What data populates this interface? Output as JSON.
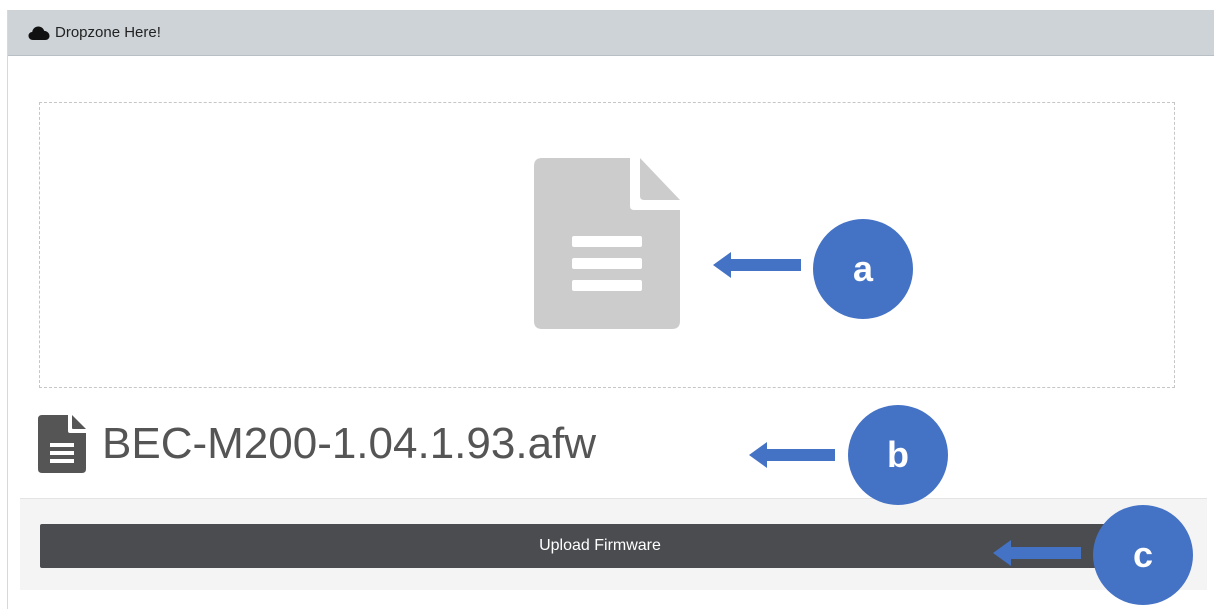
{
  "header": {
    "title": "Dropzone Here!",
    "icon": "cloud-icon"
  },
  "dropzone": {
    "icon": "file-document-icon"
  },
  "file": {
    "name": "BEC-M200-1.04.1.93.afw",
    "icon": "file-text-icon"
  },
  "actions": {
    "upload_label": "Upload Firmware"
  },
  "callouts": [
    {
      "label": "a"
    },
    {
      "label": "b"
    },
    {
      "label": "c"
    }
  ],
  "colors": {
    "header_bg": "#cdd3d7",
    "button_bg": "#4a4c50",
    "callout": "#4472c4",
    "doc_icon": "#cccccc",
    "file_icon": "#555555"
  }
}
